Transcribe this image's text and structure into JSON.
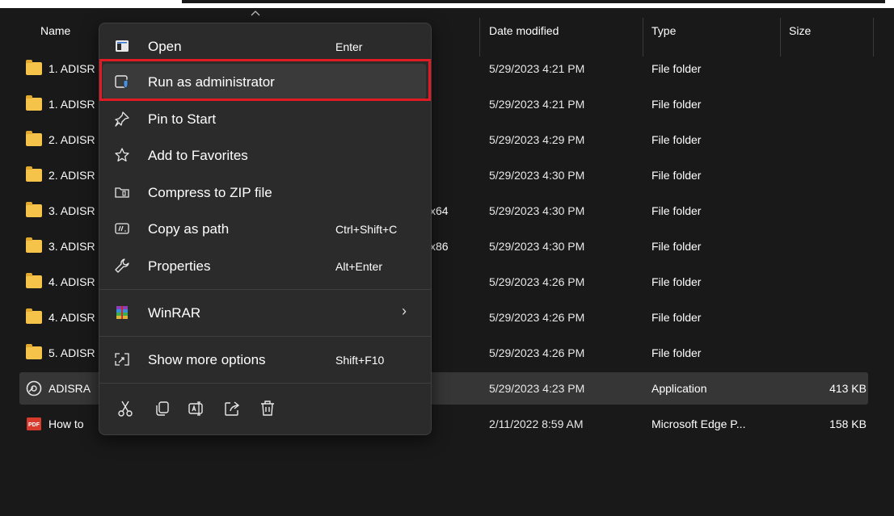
{
  "columns": {
    "name": "Name",
    "date": "Date modified",
    "type": "Type",
    "size": "Size"
  },
  "rows": [
    {
      "name": "1. ADISR",
      "date": "5/29/2023 4:21 PM",
      "type": "File folder",
      "size": "",
      "extra": "",
      "icon": "folder-icon"
    },
    {
      "name": "1. ADISR",
      "date": "5/29/2023 4:21 PM",
      "type": "File folder",
      "size": "",
      "extra": "",
      "icon": "folder-icon"
    },
    {
      "name": "2. ADISR",
      "date": "5/29/2023 4:29 PM",
      "type": "File folder",
      "size": "",
      "extra": "",
      "icon": "folder-icon"
    },
    {
      "name": "2. ADISR",
      "date": "5/29/2023 4:30 PM",
      "type": "File folder",
      "size": "",
      "extra": "",
      "icon": "folder-icon"
    },
    {
      "name": "3. ADISR",
      "date": "5/29/2023 4:30 PM",
      "type": "File folder",
      "size": "",
      "extra": "x64",
      "icon": "folder-icon"
    },
    {
      "name": "3. ADISR",
      "date": "5/29/2023 4:30 PM",
      "type": "File folder",
      "size": "",
      "extra": "x86",
      "icon": "folder-icon"
    },
    {
      "name": "4. ADISR",
      "date": "5/29/2023 4:26 PM",
      "type": "File folder",
      "size": "",
      "extra": "",
      "icon": "folder-icon"
    },
    {
      "name": "4. ADISR",
      "date": "5/29/2023 4:26 PM",
      "type": "File folder",
      "size": "",
      "extra": "",
      "icon": "folder-icon"
    },
    {
      "name": "5. ADISR",
      "date": "5/29/2023 4:26 PM",
      "type": "File folder",
      "size": "",
      "extra": "",
      "icon": "folder-icon"
    },
    {
      "name": "ADISRA",
      "date": "5/29/2023 4:23 PM",
      "type": "Application",
      "size": "413 KB",
      "extra": "",
      "icon": "installer-disc-icon"
    },
    {
      "name": "How to",
      "date": "2/11/2022 8:59 AM",
      "type": "Microsoft Edge P...",
      "size": "158 KB",
      "extra": "",
      "icon": "pdf-icon"
    }
  ],
  "menu": {
    "items": [
      {
        "label": "Open",
        "shortcut": "Enter",
        "icon": "open-icon"
      },
      {
        "label": "Run as administrator",
        "shortcut": "",
        "icon": "shield-window-icon"
      },
      {
        "label": "Pin to Start",
        "shortcut": "",
        "icon": "pin-icon"
      },
      {
        "label": "Add to Favorites",
        "shortcut": "",
        "icon": "star-icon"
      },
      {
        "label": "Compress to ZIP file",
        "shortcut": "",
        "icon": "zip-icon"
      },
      {
        "label": "Copy as path",
        "shortcut": "Ctrl+Shift+C",
        "icon": "copy-path-icon"
      },
      {
        "label": "Properties",
        "shortcut": "Alt+Enter",
        "icon": "wrench-icon"
      },
      {
        "label": "WinRAR",
        "shortcut": "",
        "icon": "winrar-icon",
        "arrow": "›"
      },
      {
        "label": "Show more options",
        "shortcut": "Shift+F10",
        "icon": "show-more-icon"
      }
    ],
    "quick_actions": [
      "cut-icon",
      "copy-icon",
      "rename-icon",
      "share-icon",
      "delete-icon"
    ]
  },
  "colors": {
    "highlight_border": "#e01b24",
    "folder": "#f5c24a",
    "background": "#191919",
    "menu_bg": "#2b2b2b"
  }
}
